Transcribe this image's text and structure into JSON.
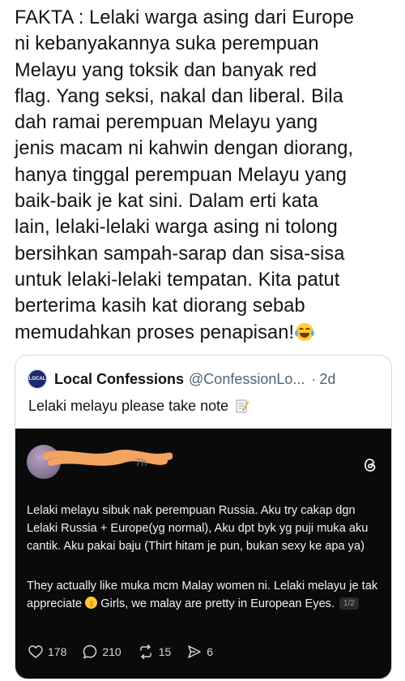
{
  "tweet": {
    "text": "FAKTA : Lelaki warga asing dari Europe\nni kebanyakannya suka perempuan\nMelayu yang toksik dan banyak red\nflag. Yang seksi, nakal dan liberal. Bila\ndah ramai perempuan Melayu yang\njenis macam ni kahwin dengan diorang,\nhanya tinggal perempuan Melayu yang\nbaik-baik je kat sini. Dalam erti kata\nlain, lelaki-lelaki warga asing ni tolong\nbersihkan sampah-sarap dan sisa-sisa\nuntuk lelaki-lelaki tempatan. Kita patut\nberterima kasih kat diorang sebab\nmemudahkan proses penapisan!",
    "emoji": "face-with-tears-of-joy-icon"
  },
  "quote": {
    "avatar_text": "LOCAL",
    "name": "Local Confessions",
    "handle": "@ConfessionLo...",
    "dot": "·",
    "time": "2d",
    "text": "Lelaki melayu please take note",
    "text_icon": "memo-icon"
  },
  "threads": {
    "time_fragment": "7h",
    "para1": "Lelaki melayu sibuk nak perempuan Russia. Aku try cakap dgn Lelaki Russia + Europe(yg normal), Aku dpt byk yg puji muka aku cantik. Aku pakai baju (Thirt hitam je pun, bukan sexy ke apa ya)",
    "para2_a": "They actually like muka mcm Malay women ni. Lelaki melayu je tak appreciate",
    "para2_b": "Girls, we malay are pretty in European Eyes.",
    "page_badge": "1/2",
    "actions": {
      "likes": "178",
      "replies": "210",
      "reposts": "15",
      "shares": "6"
    }
  },
  "colors": {
    "text": "#0f1419",
    "secondary": "#536471",
    "border": "#cfd9de",
    "threads_bg": "#0a0a0a",
    "scribble": "#f4a460"
  }
}
